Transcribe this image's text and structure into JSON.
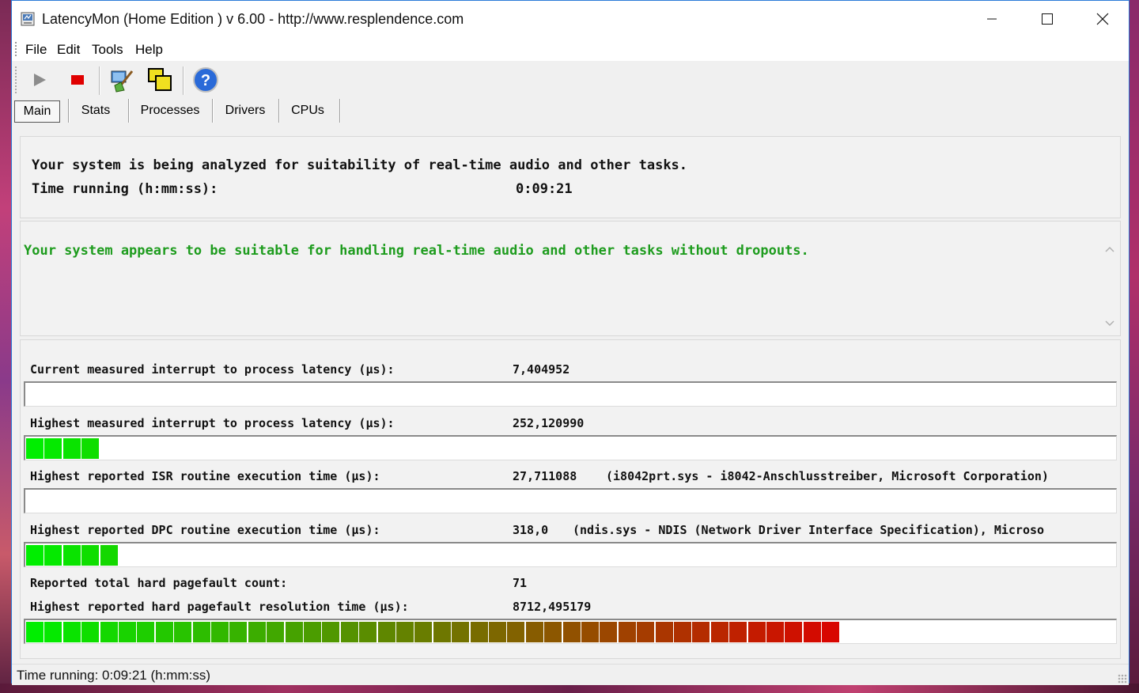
{
  "window": {
    "title": "LatencyMon  (Home Edition )  v 6.00 - http://www.resplendence.com"
  },
  "menu": [
    "File",
    "Edit",
    "Tools",
    "Help"
  ],
  "toolbar": {
    "icons": [
      "play-icon",
      "stop-icon",
      "broom-icon",
      "windows-icon",
      "help-icon"
    ]
  },
  "tabs": [
    "Main",
    "Stats",
    "Processes",
    "Drivers",
    "CPUs"
  ],
  "analysis": {
    "message": "Your system is being analyzed for suitability of real-time audio and other tasks.",
    "time_label": "Time running (h:mm:ss):",
    "time_value": "0:09:21"
  },
  "verdict": {
    "text": "Your system appears to be suitable for handling real-time audio and other tasks without dropouts.",
    "color": "#1e9c1e"
  },
  "metrics": {
    "current_latency": {
      "label": "Current measured interrupt to process latency (µs):",
      "value": "7,404952",
      "bar_segments": 0
    },
    "highest_latency": {
      "label": "Highest measured interrupt to process latency (µs):",
      "value": "252,120990",
      "bar_segments": 4
    },
    "isr": {
      "label": "Highest reported ISR routine execution time (µs):",
      "value": "27,711088",
      "detail": "(i8042prt.sys - i8042-Anschlusstreiber, Microsoft Corporation)",
      "bar_segments": 0
    },
    "dpc": {
      "label": "Highest reported DPC routine execution time (µs):",
      "value": "318,0",
      "detail": "(ndis.sys - NDIS (Network Driver Interface Specification), Microso",
      "bar_segments": 5
    },
    "pagefault_count": {
      "label": "Reported total hard pagefault count:",
      "value": "71"
    },
    "pagefault_time": {
      "label": "Highest reported hard pagefault resolution time (µs):",
      "value": "8712,495179",
      "bar_segments": 44
    }
  },
  "status": {
    "text": "Time running: 0:09:21  (h:mm:ss)"
  },
  "colors": {
    "bar_start": "#00ee00",
    "bar_end": "#dd0000",
    "titlebar_border": "#2b7bd8"
  }
}
